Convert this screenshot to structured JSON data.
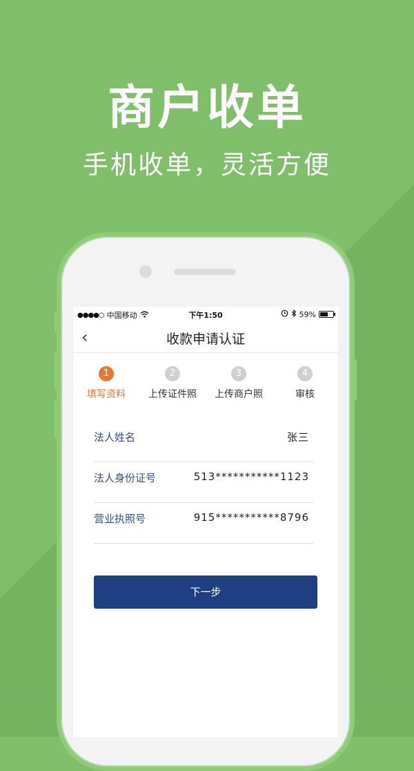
{
  "promo": {
    "title": "商户收单",
    "subtitle": "手机收单，灵活方便"
  },
  "colors": {
    "background": "#7fbf6a",
    "accent": "#e27a34",
    "primary_button": "#1e3f82",
    "label_blue": "#2f4f8f"
  },
  "status_bar": {
    "carrier": "中国移动",
    "time": "下午1:50",
    "battery": "59%",
    "battery_level": 0.59,
    "icons": [
      "signal-dots-icon",
      "wifi-icon",
      "alarm-icon",
      "bluetooth-icon",
      "battery-icon"
    ]
  },
  "nav": {
    "back_icon": "chevron-left-icon",
    "title": "收款申请认证"
  },
  "steps": [
    {
      "number": "1",
      "label": "填写资料",
      "active": true
    },
    {
      "number": "2",
      "label": "上传证件照",
      "active": false
    },
    {
      "number": "3",
      "label": "上传商户照",
      "active": false
    },
    {
      "number": "4",
      "label": "审核",
      "active": false
    }
  ],
  "form": {
    "rows": [
      {
        "label": "法人姓名",
        "value": "张三"
      },
      {
        "label": "法人身份证号",
        "value": "513***********1123"
      },
      {
        "label": "营业执照号",
        "value": "915***********8796"
      }
    ]
  },
  "next_button": "下一步"
}
